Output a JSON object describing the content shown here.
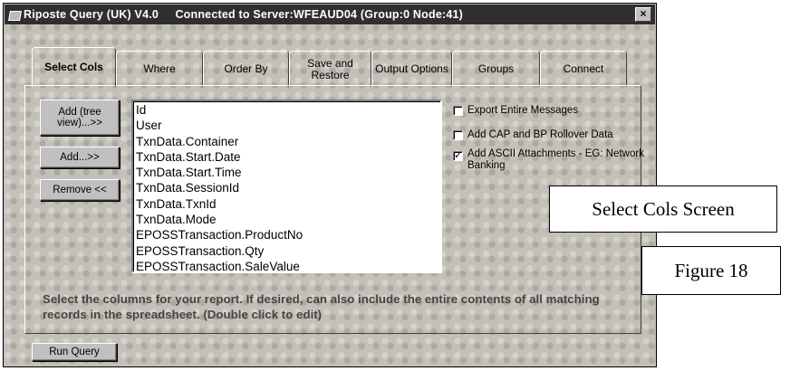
{
  "window": {
    "title": "Riposte Query (UK) V4.0     Connected to Server:WFEAUD04 (Group:0 Node:41)",
    "close_glyph": "×"
  },
  "tabs": [
    {
      "label": "Select Cols",
      "active": true
    },
    {
      "label": "Where"
    },
    {
      "label": "Order By"
    },
    {
      "label": "Save and Restore"
    },
    {
      "label": "Output Options"
    },
    {
      "label": "Groups"
    },
    {
      "label": "Connect"
    }
  ],
  "buttons": {
    "add_tree": "Add (tree view)...>>",
    "add": "Add...>>",
    "remove": "Remove <<",
    "run_query": "Run Query"
  },
  "columns": [
    "Id",
    "User",
    "TxnData.Container",
    "TxnData.Start.Date",
    "TxnData.Start.Time",
    "TxnData.SessionId",
    "TxnData.TxnId",
    "TxnData.Mode",
    "EPOSSTransaction.ProductNo",
    "EPOSSTransaction.Qty",
    "EPOSSTransaction.SaleValue"
  ],
  "options": [
    {
      "label": "Export Entire Messages",
      "checked": false
    },
    {
      "label": "Add CAP and BP Rollover Data",
      "checked": false
    },
    {
      "label": "Add ASCII Attachments - EG: Network Banking",
      "checked": true
    }
  ],
  "hint": "Select the columns for your report.  If desired, can also include the entire contents of all matching records in the spreadsheet. (Double click to edit)",
  "callouts": {
    "screen_label": "Select Cols Screen",
    "figure_label": "Figure 18"
  }
}
